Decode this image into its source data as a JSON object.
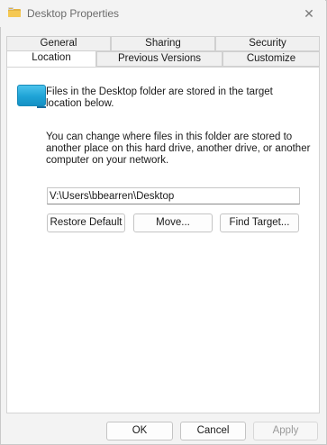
{
  "window": {
    "title": "Desktop Properties",
    "close_glyph": "✕",
    "title_icon": "folder-icon"
  },
  "tabs": {
    "row1": [
      "General",
      "Sharing",
      "Security"
    ],
    "row2": [
      "Location",
      "Previous Versions",
      "Customize"
    ],
    "active": "Location"
  },
  "location": {
    "folder_icon": "desktop-folder-icon",
    "intro": "Files in the Desktop folder are stored in the target location below.",
    "description": "You can change where files in this folder are stored to another place on this hard drive, another drive, or another computer on your network.",
    "path_value": "V:\\Users\\bbearren\\Desktop",
    "restore_default_label": "Restore Default",
    "move_label": "Move...",
    "find_target_label": "Find Target..."
  },
  "footer": {
    "ok_label": "OK",
    "cancel_label": "Cancel",
    "apply_label": "Apply",
    "apply_enabled": false
  }
}
